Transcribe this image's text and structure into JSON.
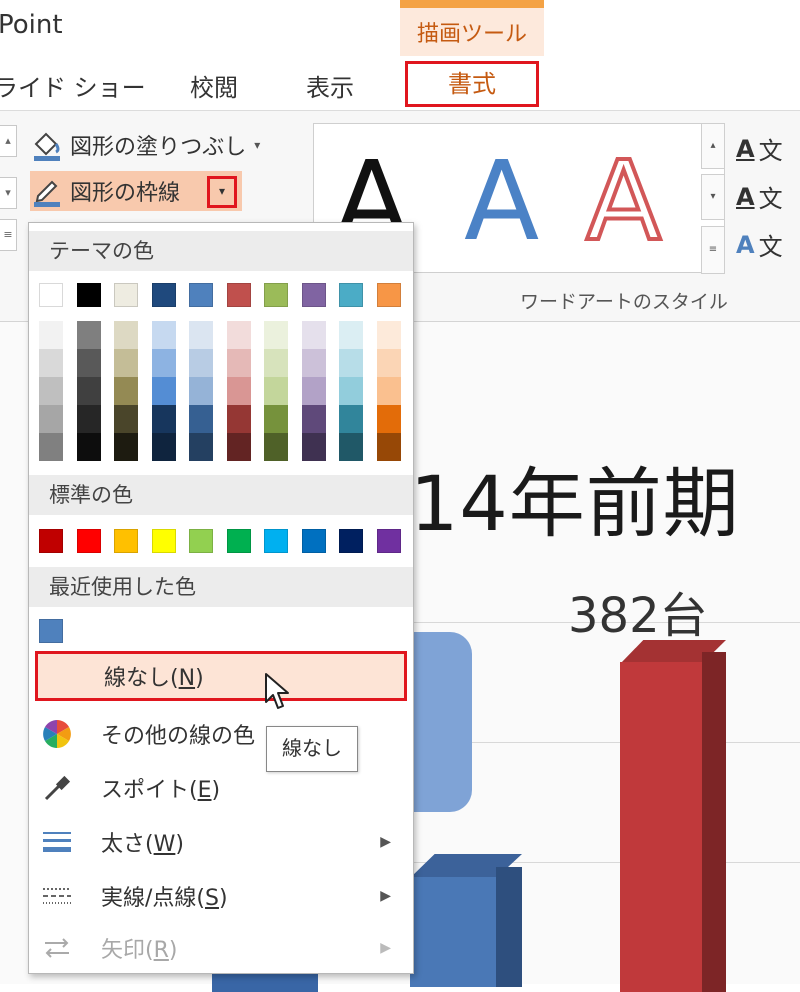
{
  "app": {
    "title": "Point"
  },
  "context_tab": {
    "group": "描画ツール",
    "active_tab": "書式"
  },
  "tabs": [
    "ライド ショー",
    "校閲",
    "表示"
  ],
  "ribbon": {
    "fill_label": "図形の塗りつぶし",
    "outline_label": "図形の枠線",
    "wordart_group": "ワードアートのスタイル",
    "wordart_letter": "A",
    "side_text": "文"
  },
  "slide": {
    "title": "14年前期",
    "value_label": "382台"
  },
  "menu": {
    "theme_header": "テーマの色",
    "standard_header": "標準の色",
    "recent_header": "最近使用した色",
    "theme_colors": [
      "#ffffff",
      "#000000",
      "#eeece1",
      "#1f497d",
      "#4f81bd",
      "#c0504d",
      "#9bbb59",
      "#8064a2",
      "#4bacc6",
      "#f79646"
    ],
    "theme_shades": [
      [
        "#f2f2f2",
        "#d9d9d9",
        "#bfbfbf",
        "#a6a6a6",
        "#808080"
      ],
      [
        "#7f7f7f",
        "#595959",
        "#404040",
        "#262626",
        "#0d0d0d"
      ],
      [
        "#ddd9c3",
        "#c4bd97",
        "#948a54",
        "#4a452a",
        "#1d1b10"
      ],
      [
        "#c6d9f0",
        "#8db3e2",
        "#548dd4",
        "#17365d",
        "#0f243e"
      ],
      [
        "#dbe5f1",
        "#b8cce4",
        "#95b3d7",
        "#366092",
        "#244061"
      ],
      [
        "#f2dcdb",
        "#e5b9b7",
        "#d99694",
        "#953734",
        "#632423"
      ],
      [
        "#ebf1dd",
        "#d7e3bc",
        "#c3d69b",
        "#76923c",
        "#4f6128"
      ],
      [
        "#e5e0ec",
        "#ccc1d9",
        "#b2a2c7",
        "#5f497a",
        "#3f3151"
      ],
      [
        "#dbeef3",
        "#b7dde8",
        "#92cddc",
        "#31859b",
        "#205867"
      ],
      [
        "#fdeada",
        "#fbd5b5",
        "#fac08f",
        "#e36c09",
        "#974806"
      ]
    ],
    "standard_colors": [
      "#c00000",
      "#ff0000",
      "#ffc000",
      "#ffff00",
      "#92d050",
      "#00b050",
      "#00b0f0",
      "#0070c0",
      "#002060",
      "#7030a0"
    ],
    "recent_colors": [
      "#4f81bd"
    ],
    "items": {
      "no_line": {
        "text": "線なし(",
        "key": "N",
        "close": ")"
      },
      "more_colors": {
        "text": "その他の線の色"
      },
      "eyedropper": {
        "text": "スポイト(",
        "key": "E",
        "close": ")"
      },
      "weight": {
        "text": "太さ(",
        "key": "W",
        "close": ")"
      },
      "dashes": {
        "text": "実線/点線(",
        "key": "S",
        "close": ")"
      },
      "arrows": {
        "text": "矢印(",
        "key": "R",
        "close": ")"
      }
    }
  },
  "tooltip": {
    "text": "線なし"
  }
}
